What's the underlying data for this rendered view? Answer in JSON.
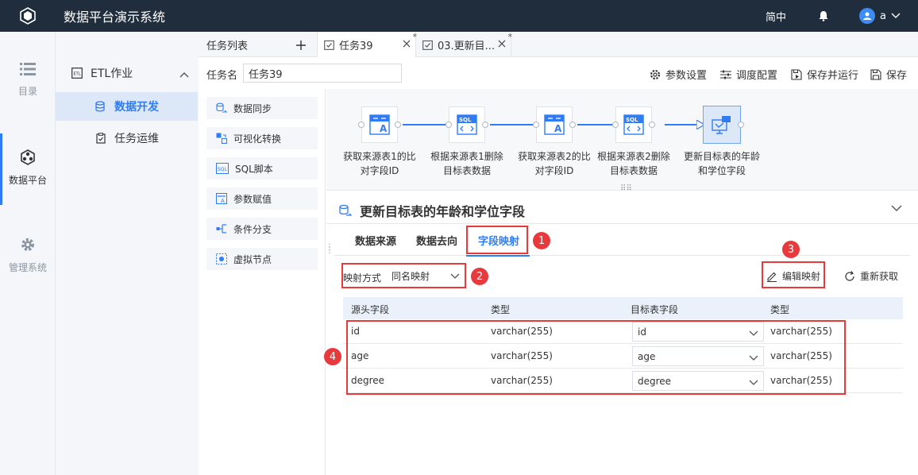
{
  "app": {
    "title": "数据平台演示系统"
  },
  "header": {
    "language": "简中",
    "username": "a"
  },
  "leftnav": {
    "items": [
      {
        "label": "目录",
        "icon": "list-icon"
      },
      {
        "label": "数据平台",
        "icon": "cube-icon",
        "active": true
      },
      {
        "label": "管理系统",
        "icon": "gear-icon"
      }
    ]
  },
  "subnav": {
    "group": "ETL作业",
    "items": [
      {
        "label": "数据开发",
        "active": true
      },
      {
        "label": "任务运维"
      }
    ]
  },
  "tabs": {
    "task_list": "任务列表",
    "items": [
      {
        "label": "任务39",
        "active": true
      },
      {
        "label": "03.更新目..."
      }
    ]
  },
  "task": {
    "name_label": "任务名",
    "name_value": "任务39"
  },
  "toolbar": {
    "param_settings": "参数设置",
    "schedule_config": "调度配置",
    "save_and_run": "保存并运行",
    "save": "保存"
  },
  "palette": [
    "数据同步",
    "可视化转换",
    "SQL脚本",
    "参数赋值",
    "条件分支",
    "虚拟节点"
  ],
  "flow": {
    "nodes": [
      {
        "label1": "获取来源表1的比",
        "label2": "对字段ID",
        "type": "transform"
      },
      {
        "label1": "根据来源表1删除",
        "label2": "目标表数据",
        "type": "sql"
      },
      {
        "label1": "获取来源表2的比",
        "label2": "对字段ID",
        "type": "transform"
      },
      {
        "label1": "根据来源表2删除",
        "label2": "目标表数据",
        "type": "sql"
      },
      {
        "label1": "更新目标表的年龄",
        "label2": "和学位字段",
        "type": "sync",
        "selected": true
      }
    ]
  },
  "detail": {
    "title": "更新目标表的年龄和学位字段",
    "subtabs": [
      "数据来源",
      "数据去向",
      "字段映射"
    ],
    "active_subtab": "字段映射",
    "mapping_label": "映射方式",
    "mapping_value": "同名映射",
    "edit_mapping": "编辑映射",
    "refetch": "重新获取",
    "badges": [
      "1",
      "2",
      "3",
      "4"
    ]
  },
  "mapping_table": {
    "headers": [
      "源头字段",
      "类型",
      "目标表字段",
      "类型"
    ],
    "rows": [
      {
        "source": "id",
        "source_type": "varchar(255)",
        "target": "id",
        "target_type": "varchar(255)"
      },
      {
        "source": "age",
        "source_type": "varchar(255)",
        "target": "age",
        "target_type": "varchar(255)"
      },
      {
        "source": "degree",
        "source_type": "varchar(255)",
        "target": "degree",
        "target_type": "varchar(255)"
      }
    ]
  },
  "colors": {
    "accent": "#2f7cf6",
    "topbar": "#1f2d3d",
    "annotation": "#e8393c"
  }
}
